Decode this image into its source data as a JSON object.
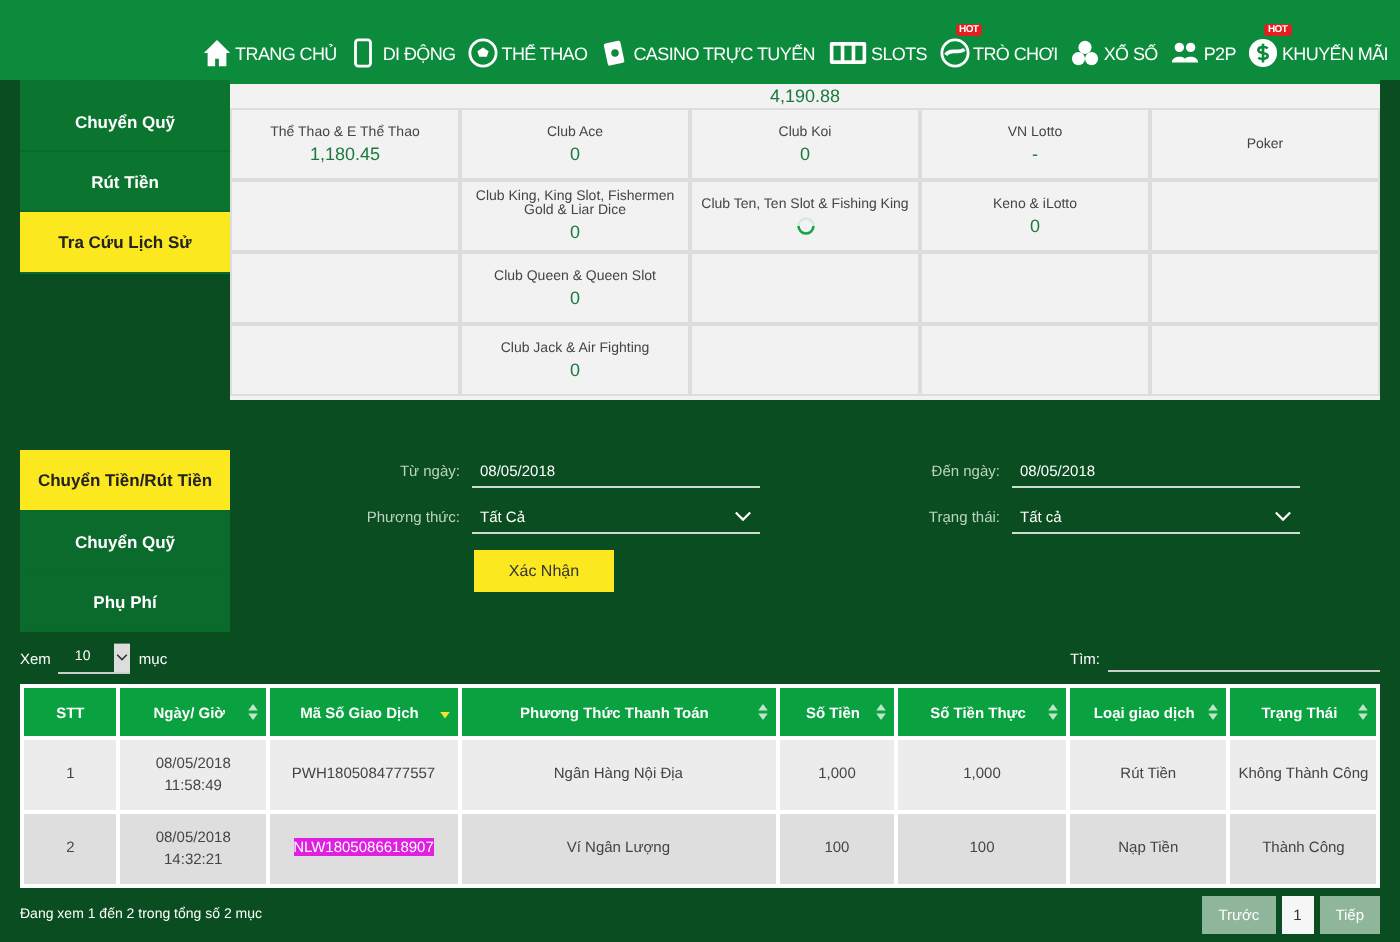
{
  "nav": [
    {
      "label": "TRANG CHỦ"
    },
    {
      "label": "DI ĐỘNG"
    },
    {
      "label": "THỂ THAO"
    },
    {
      "label": "CASINO TRỰC TUYẾN"
    },
    {
      "label": "SLOTS"
    },
    {
      "label": "TRÒ CHƠI",
      "badge": "HOT"
    },
    {
      "label": "XỔ SỐ"
    },
    {
      "label": "P2P"
    },
    {
      "label": "KHUYẾN MÃI",
      "badge": "HOT"
    }
  ],
  "top_menu": [
    {
      "label": "Chuyển Quỹ",
      "selected": false
    },
    {
      "label": "Rút Tiền",
      "selected": false
    },
    {
      "label": "Tra Cứu Lịch Sử",
      "selected": true
    }
  ],
  "balance_total": "4,190.88",
  "balance_columns": [
    [
      {
        "name": "Thể Thao & E Thể Thao",
        "value": "1,180.45",
        "loading": false
      }
    ],
    [
      {
        "name": "Club Ace",
        "value": "0",
        "loading": false
      },
      {
        "name": "Club King, King Slot, Fishermen Gold & Liar Dice",
        "value": "0",
        "loading": false
      },
      {
        "name": "Club Queen & Queen Slot",
        "value": "0",
        "loading": false
      },
      {
        "name": "Club Jack & Air Fighting",
        "value": "0",
        "loading": false
      }
    ],
    [
      {
        "name": "Club Koi",
        "value": "0",
        "loading": false
      },
      {
        "name": "Club Ten, Ten Slot & Fishing King",
        "loading": true
      }
    ],
    [
      {
        "name": "VN Lotto",
        "value": "-",
        "loading": false
      },
      {
        "name": "Keno & iLotto",
        "value": "0",
        "loading": false
      }
    ],
    [
      {
        "name": "Poker",
        "loading": false
      }
    ]
  ],
  "history_menu": [
    {
      "label": "Chuyển Tiền/Rút Tiền",
      "selected": true
    },
    {
      "label": "Chuyển Quỹ",
      "selected": false
    },
    {
      "label": "Phụ Phí",
      "selected": false
    }
  ],
  "filters": [
    {
      "label": "Từ ngày:",
      "value": "08/05/2018",
      "kind": "date"
    },
    {
      "label": "Đến ngày:",
      "value": "08/05/2018",
      "kind": "date"
    },
    {
      "label": "Phương thức:",
      "value": "Tất Cả",
      "kind": "select"
    },
    {
      "label": "Trạng thái:",
      "value": "Tất cả",
      "kind": "select"
    }
  ],
  "confirm_button": "Xác Nhận",
  "page_size": {
    "prefix": "Xem",
    "value": "10",
    "suffix": "mục"
  },
  "search_label": "Tìm:",
  "table": {
    "columns": [
      {
        "label": "STT",
        "sortable": false,
        "sorted": false
      },
      {
        "label": "Ngày/ Giờ",
        "sortable": true,
        "sorted": false
      },
      {
        "label": "Mã Số Giao Dịch",
        "sortable": true,
        "sorted": true
      },
      {
        "label": "Phương Thức Thanh Toán",
        "sortable": true,
        "sorted": false
      },
      {
        "label": "Số Tiền",
        "sortable": true,
        "sorted": false
      },
      {
        "label": "Số Tiền Thực",
        "sortable": true,
        "sorted": false
      },
      {
        "label": "Loại giao dịch",
        "sortable": true,
        "sorted": false
      },
      {
        "label": "Trạng Thái",
        "sortable": true,
        "sorted": false
      }
    ],
    "rows": [
      {
        "cells": [
          "1",
          "08/05/2018\n11:58:49",
          "PWH1805084777557",
          "Ngân Hàng Nội Địa",
          "1,000",
          "1,000",
          "Rút Tiền",
          "Không Thành Công"
        ],
        "code_highlighted": false
      },
      {
        "cells": [
          "2",
          "08/05/2018\n14:32:21",
          "NLW1805086618907",
          "Ví Ngân Lượng",
          "100",
          "100",
          "Nạp Tiền",
          "Thành Công"
        ],
        "code_highlighted": true
      }
    ]
  },
  "table_info": "Đang xem 1 đến 2 trong tổng số 2 mục",
  "pagination": [
    {
      "label": "Trước",
      "selected": false
    },
    {
      "label": "1",
      "selected": true
    },
    {
      "label": "Tiếp",
      "selected": false
    }
  ]
}
